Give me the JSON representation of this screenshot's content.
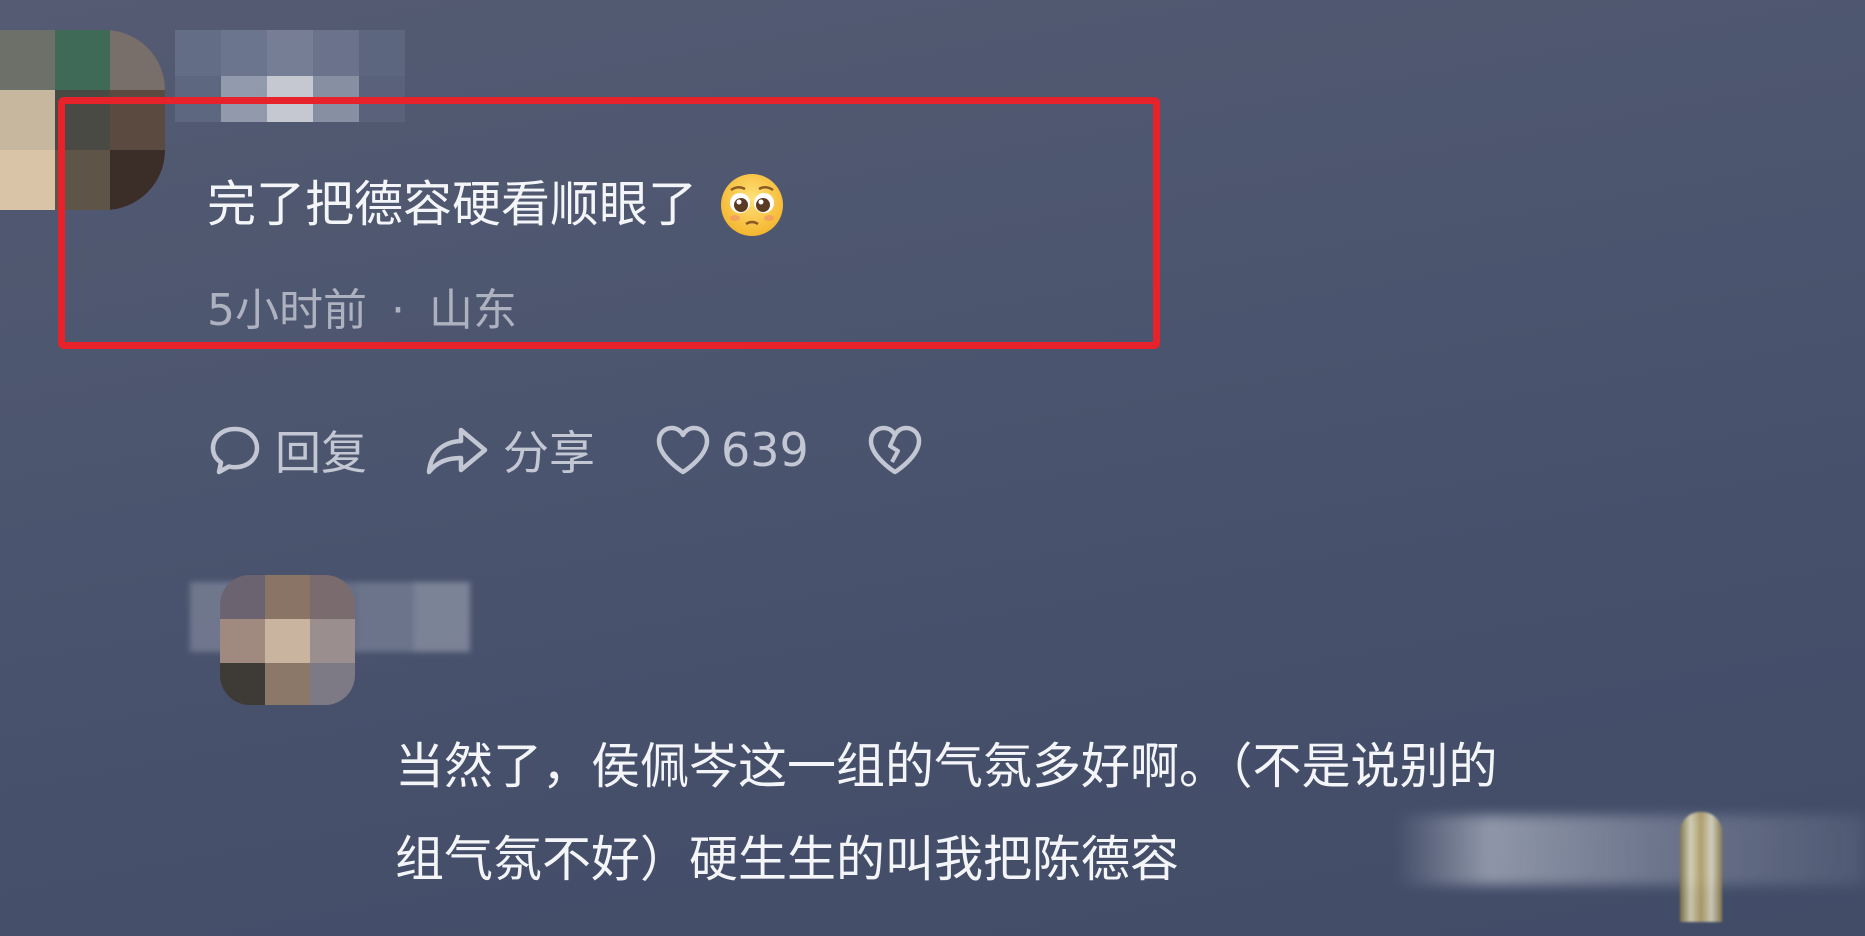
{
  "comment": {
    "text": "完了把德容硬看顺眼了",
    "emoji": "pleading-face-emoji",
    "time": "5小时前",
    "separator": "·",
    "location": "山东"
  },
  "actions": {
    "reply_label": "回复",
    "share_label": "分享",
    "like_count": "639"
  },
  "reply": {
    "line1": "当然了，侯佩岑这一组的气氛多好啊。（不是说别的",
    "line2": "组气氛不好）硬生生的叫我把陈德容"
  },
  "colors": {
    "highlight_border": "#e8222a",
    "background": "#4a536d",
    "primary_text": "#f4f5f8",
    "meta_text": "#aeb2c0",
    "icon_color": "#c3c7d3"
  }
}
